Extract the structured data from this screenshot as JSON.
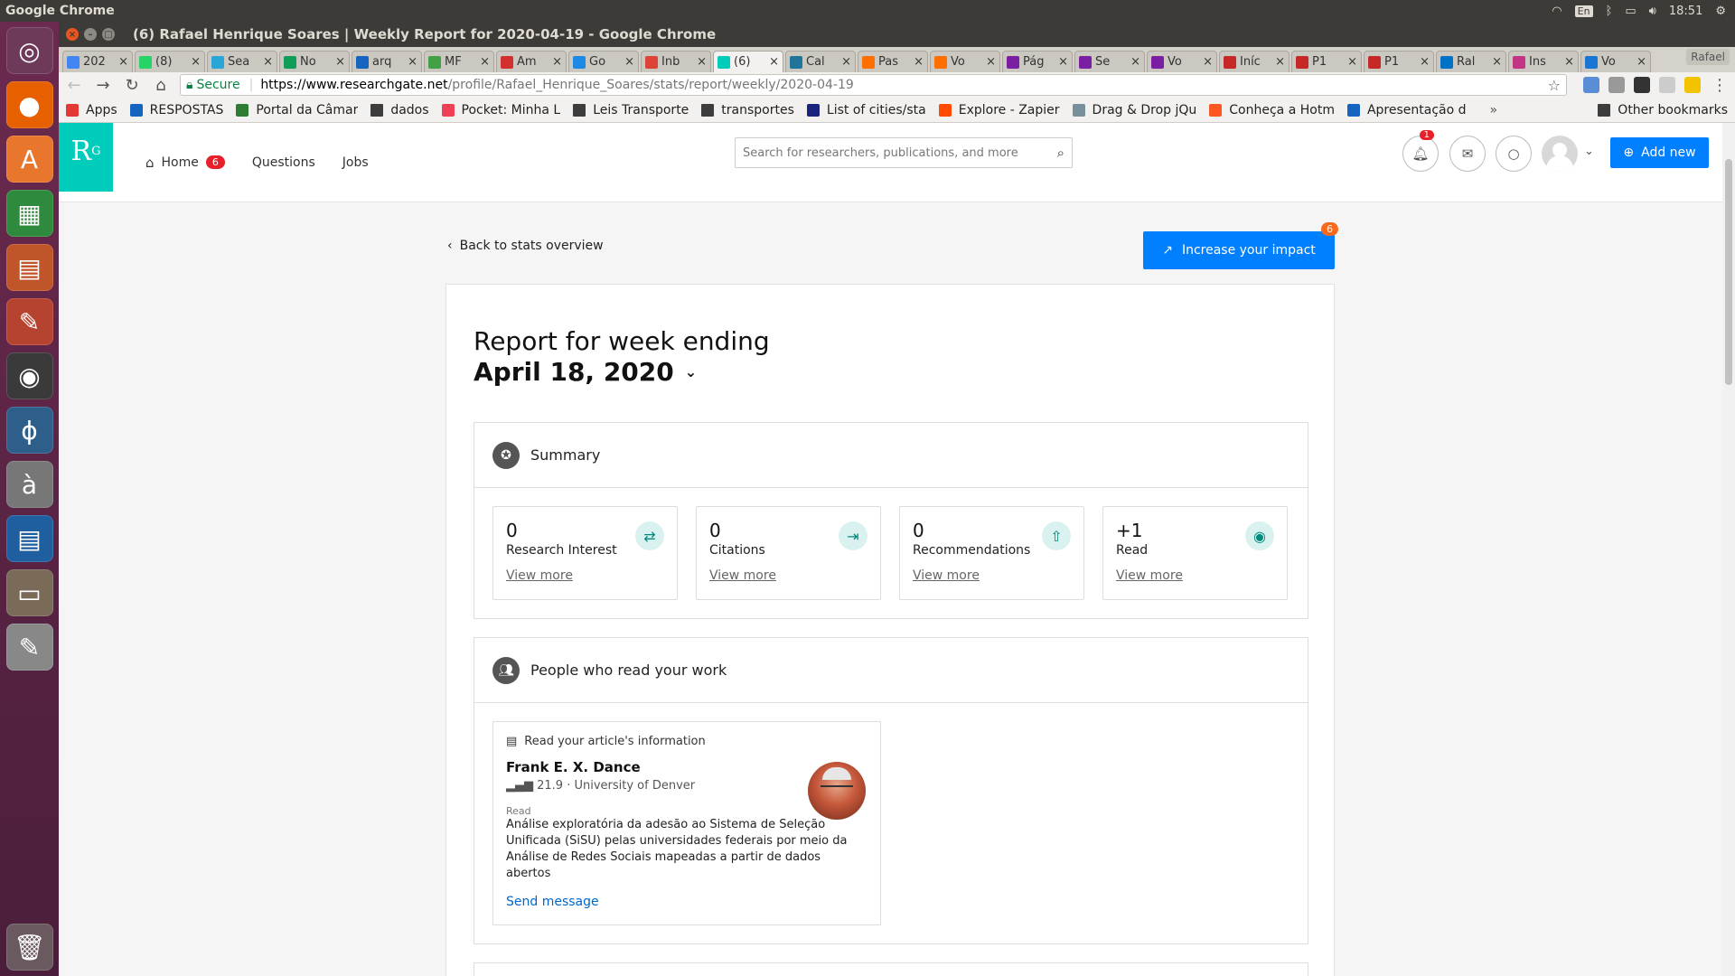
{
  "os": {
    "app_name": "Google Chrome",
    "keyboard_layout": "En",
    "time": "18:51"
  },
  "launcher": {
    "items": [
      "ubuntu-dash-icon",
      "firefox-icon",
      "software-center-icon",
      "calc-icon",
      "impress-icon",
      "settings-icon",
      "chrome-icon",
      "pgadmin-icon",
      "character-map-icon",
      "writer-icon",
      "files-icon",
      "text-editor-icon",
      "trash-icon"
    ]
  },
  "window": {
    "title": "(6) Rafael Henrique Soares | Weekly Report for 2020-04-19 - Google Chrome"
  },
  "tabs": [
    {
      "label": "202",
      "color": "#4285f4"
    },
    {
      "label": "(8)",
      "color": "#25d366"
    },
    {
      "label": "Sea",
      "color": "#2aa5d8"
    },
    {
      "label": "No",
      "color": "#0f9d58"
    },
    {
      "label": "arq",
      "color": "#1565c0"
    },
    {
      "label": "MF",
      "color": "#43a047"
    },
    {
      "label": "Am",
      "color": "#d32f2f"
    },
    {
      "label": "Go",
      "color": "#1e88e5"
    },
    {
      "label": "Inb",
      "color": "#db4437"
    },
    {
      "label": "(6)",
      "color": "#00ccbb",
      "active": true
    },
    {
      "label": "Cal",
      "color": "#21759b"
    },
    {
      "label": "Pas",
      "color": "#ff6f00"
    },
    {
      "label": "Vo",
      "color": "#ff6f00"
    },
    {
      "label": "Pág",
      "color": "#7b1fa2"
    },
    {
      "label": "Se",
      "color": "#7b1fa2"
    },
    {
      "label": "Vo",
      "color": "#7b1fa2"
    },
    {
      "label": "Iníc",
      "color": "#c62828"
    },
    {
      "label": "P1",
      "color": "#c62828"
    },
    {
      "label": "P1",
      "color": "#c62828"
    },
    {
      "label": "Ral",
      "color": "#0072c6"
    },
    {
      "label": "Ins",
      "color": "#c13584"
    },
    {
      "label": "Vo",
      "color": "#1976d2"
    }
  ],
  "profile_name": "Rafael",
  "omnibox": {
    "secure_label": "Secure",
    "host": "https://www.researchgate.net",
    "path": "/profile/Rafael_Henrique_Soares/stats/report/weekly/2020-04-19"
  },
  "bookmarks": [
    {
      "label": "Apps",
      "color": "#e53935"
    },
    {
      "label": "RESPOSTAS",
      "color": "#1565c0"
    },
    {
      "label": "Portal da Câmar",
      "color": "#2e7d32"
    },
    {
      "label": "dados",
      "color": "#3d3d3d",
      "folder": true
    },
    {
      "label": "Pocket: Minha L",
      "color": "#ef4056"
    },
    {
      "label": "Leis Transporte",
      "color": "#3d3d3d",
      "folder": true
    },
    {
      "label": "transportes",
      "color": "#3d3d3d",
      "folder": true
    },
    {
      "label": "List of cities/sta",
      "color": "#1a237e"
    },
    {
      "label": "Explore - Zapier",
      "color": "#ff4a00"
    },
    {
      "label": "Drag & Drop jQu",
      "color": "#78909c"
    },
    {
      "label": "Conheça a Hotm",
      "color": "#ff5722"
    },
    {
      "label": "Apresentação d",
      "color": "#1565c0"
    }
  ],
  "bookmarks_more": "»",
  "other_bookmarks": "Other bookmarks",
  "rg": {
    "logo": "R",
    "logo_sup": "G",
    "nav": {
      "home": "Home",
      "home_badge": "6",
      "questions": "Questions",
      "jobs": "Jobs"
    },
    "search_placeholder": "Search for researchers, publications, and more",
    "notif_badge": "1",
    "add_new": "Add new",
    "back_link": "Back to stats overview",
    "impact_button": "Increase your impact",
    "impact_badge": "6",
    "report_title": "Report for week ending",
    "report_date": "April 18, 2020",
    "summary": {
      "title": "Summary",
      "stats": [
        {
          "value": "0",
          "label": "Research Interest",
          "more": "View more",
          "icon": "research-interest-icon"
        },
        {
          "value": "0",
          "label": "Citations",
          "more": "View more",
          "icon": "citations-icon"
        },
        {
          "value": "0",
          "label": "Recommendations",
          "more": "View more",
          "icon": "recommendations-icon"
        },
        {
          "value": "+1",
          "label": "Read",
          "more": "View more",
          "icon": "read-eye-icon"
        }
      ]
    },
    "readers": {
      "title": "People who read your work",
      "card": {
        "head": "Read your article's information",
        "name": "Frank E. X. Dance",
        "institution": "21.9 · University of Denver",
        "read_label": "Read",
        "article": "Análise exploratória da adesão ao Sistema de Seleção Unificada (SiSU) pelas universidades federais por meio da Análise de Redes Sociais mapeadas a partir de dados abertos",
        "send": "Send message"
      }
    }
  }
}
